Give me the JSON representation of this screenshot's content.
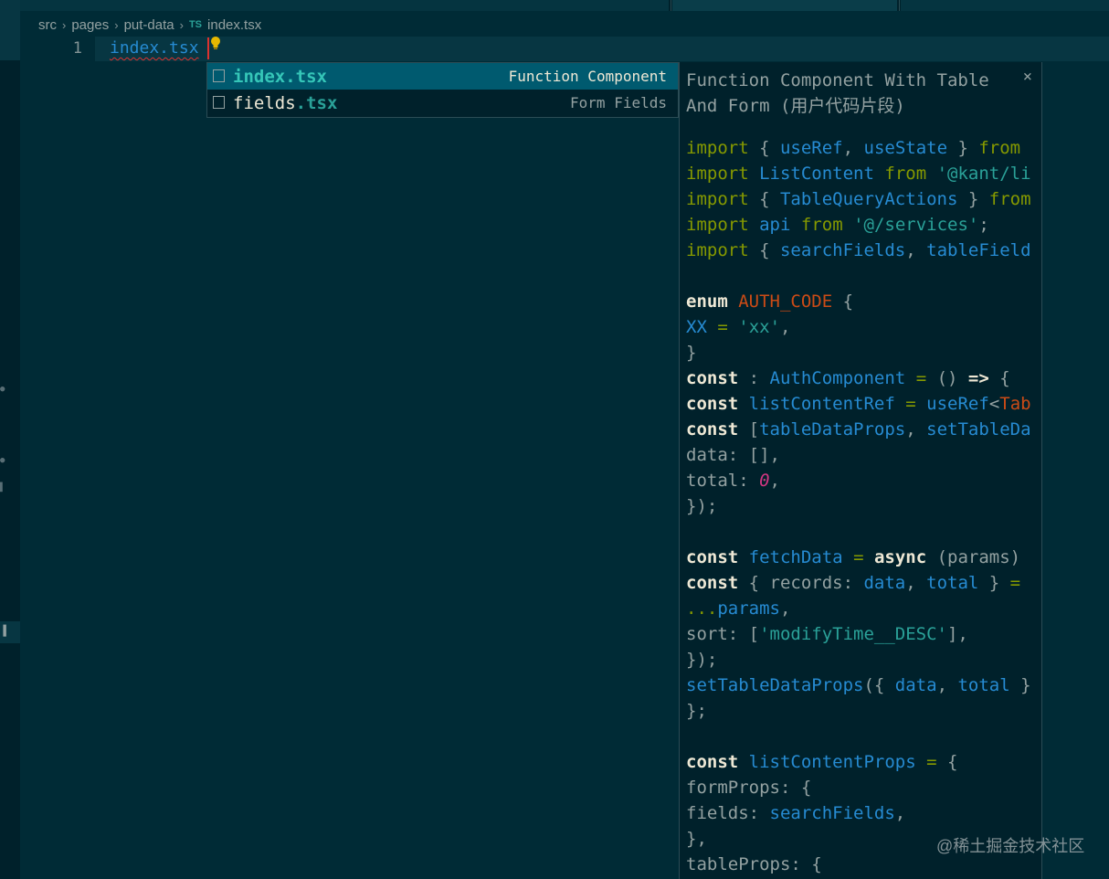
{
  "breadcrumb": [
    "src",
    "pages",
    "put-data",
    "index.tsx"
  ],
  "file_badge": "TS",
  "editor": {
    "line_number": "1",
    "typed_text": "index.tsx"
  },
  "suggestions": [
    {
      "prefix": "",
      "highlight": "index.tsx",
      "detail": "Function Component"
    },
    {
      "prefix": "fields",
      "highlight": ".tsx",
      "detail": "Form Fields"
    }
  ],
  "docs": {
    "title": "Function Component With Table And Form (用户代码片段)",
    "close_glyph": "×",
    "lines": [
      [
        [
          "k",
          "import"
        ],
        [
          "p",
          " { "
        ],
        [
          "b",
          "useRef"
        ],
        [
          "p",
          ", "
        ],
        [
          "b",
          "useState"
        ],
        [
          "p",
          " } "
        ],
        [
          "k",
          "from"
        ]
      ],
      [
        [
          "k",
          "import"
        ],
        [
          "p",
          " "
        ],
        [
          "b",
          "ListContent"
        ],
        [
          "p",
          " "
        ],
        [
          "k",
          "from"
        ],
        [
          "p",
          " "
        ],
        [
          "s",
          "'@kant/li"
        ]
      ],
      [
        [
          "k",
          "import"
        ],
        [
          "p",
          " { "
        ],
        [
          "b",
          "TableQueryActions"
        ],
        [
          "p",
          " } "
        ],
        [
          "k",
          "from"
        ]
      ],
      [
        [
          "k",
          "import"
        ],
        [
          "p",
          " "
        ],
        [
          "b",
          "api"
        ],
        [
          "p",
          " "
        ],
        [
          "k",
          "from"
        ],
        [
          "p",
          " "
        ],
        [
          "s",
          "'@/services'"
        ],
        [
          "p",
          ";"
        ]
      ],
      [
        [
          "k",
          "import"
        ],
        [
          "p",
          " { "
        ],
        [
          "b",
          "searchFields"
        ],
        [
          "p",
          ", "
        ],
        [
          "b",
          "tableField"
        ]
      ],
      [],
      [
        [
          "w",
          "enum"
        ],
        [
          "p",
          " "
        ],
        [
          "o",
          "AUTH_CODE"
        ],
        [
          "p",
          " {"
        ]
      ],
      [
        [
          "b",
          "XX"
        ],
        [
          "p",
          " "
        ],
        [
          "k",
          "="
        ],
        [
          "p",
          " "
        ],
        [
          "s",
          "'xx'"
        ],
        [
          "p",
          ","
        ]
      ],
      [
        [
          "p",
          "}"
        ]
      ],
      [
        [
          "w",
          "const"
        ],
        [
          "p",
          " : "
        ],
        [
          "b",
          "AuthComponent"
        ],
        [
          "p",
          " "
        ],
        [
          "k",
          "="
        ],
        [
          "p",
          " () "
        ],
        [
          "w",
          "=>"
        ],
        [
          "p",
          " {"
        ]
      ],
      [
        [
          "w",
          "const"
        ],
        [
          "p",
          " "
        ],
        [
          "b",
          "listContentRef"
        ],
        [
          "p",
          " "
        ],
        [
          "k",
          "="
        ],
        [
          "p",
          " "
        ],
        [
          "b",
          "useRef"
        ],
        [
          "p",
          "<"
        ],
        [
          "o",
          "Tab"
        ]
      ],
      [
        [
          "w",
          "const"
        ],
        [
          "p",
          " ["
        ],
        [
          "b",
          "tableDataProps"
        ],
        [
          "p",
          ", "
        ],
        [
          "b",
          "setTableDa"
        ]
      ],
      [
        [
          "p",
          "data: [],"
        ]
      ],
      [
        [
          "p",
          "total: "
        ],
        [
          "n",
          "0"
        ],
        [
          "p",
          ","
        ]
      ],
      [
        [
          "p",
          "});"
        ]
      ],
      [],
      [
        [
          "w",
          "const"
        ],
        [
          "p",
          " "
        ],
        [
          "b",
          "fetchData"
        ],
        [
          "p",
          " "
        ],
        [
          "k",
          "="
        ],
        [
          "p",
          " "
        ],
        [
          "w",
          "async"
        ],
        [
          "p",
          " (params)"
        ]
      ],
      [
        [
          "w",
          "const"
        ],
        [
          "p",
          " { records: "
        ],
        [
          "b",
          "data"
        ],
        [
          "p",
          ", "
        ],
        [
          "b",
          "total"
        ],
        [
          "p",
          " } "
        ],
        [
          "k",
          "="
        ]
      ],
      [
        [
          "k",
          "..."
        ],
        [
          "b",
          "params"
        ],
        [
          "p",
          ","
        ]
      ],
      [
        [
          "p",
          "sort: ["
        ],
        [
          "s",
          "'modifyTime__DESC'"
        ],
        [
          "p",
          "],"
        ]
      ],
      [
        [
          "p",
          "});"
        ]
      ],
      [
        [
          "b",
          "setTableDataProps"
        ],
        [
          "p",
          "({ "
        ],
        [
          "b",
          "data"
        ],
        [
          "p",
          ", "
        ],
        [
          "b",
          "total"
        ],
        [
          "p",
          " }"
        ]
      ],
      [
        [
          "p",
          "};"
        ]
      ],
      [],
      [
        [
          "w",
          "const"
        ],
        [
          "p",
          " "
        ],
        [
          "b",
          "listContentProps"
        ],
        [
          "p",
          " "
        ],
        [
          "k",
          "="
        ],
        [
          "p",
          " {"
        ]
      ],
      [
        [
          "p",
          "formProps: {"
        ]
      ],
      [
        [
          "p",
          "fields: "
        ],
        [
          "b",
          "searchFields"
        ],
        [
          "p",
          ","
        ]
      ],
      [
        [
          "p",
          "},"
        ]
      ],
      [
        [
          "p",
          "tableProps: {"
        ]
      ]
    ]
  },
  "watermark": "@稀土掘金技术社区",
  "colors": {
    "background": "#002b36",
    "keyword": "#859900",
    "identifier": "#268bd2",
    "string": "#2aa198",
    "constant": "#cb4b16",
    "number": "#d33682",
    "selection": "#005a6f"
  }
}
